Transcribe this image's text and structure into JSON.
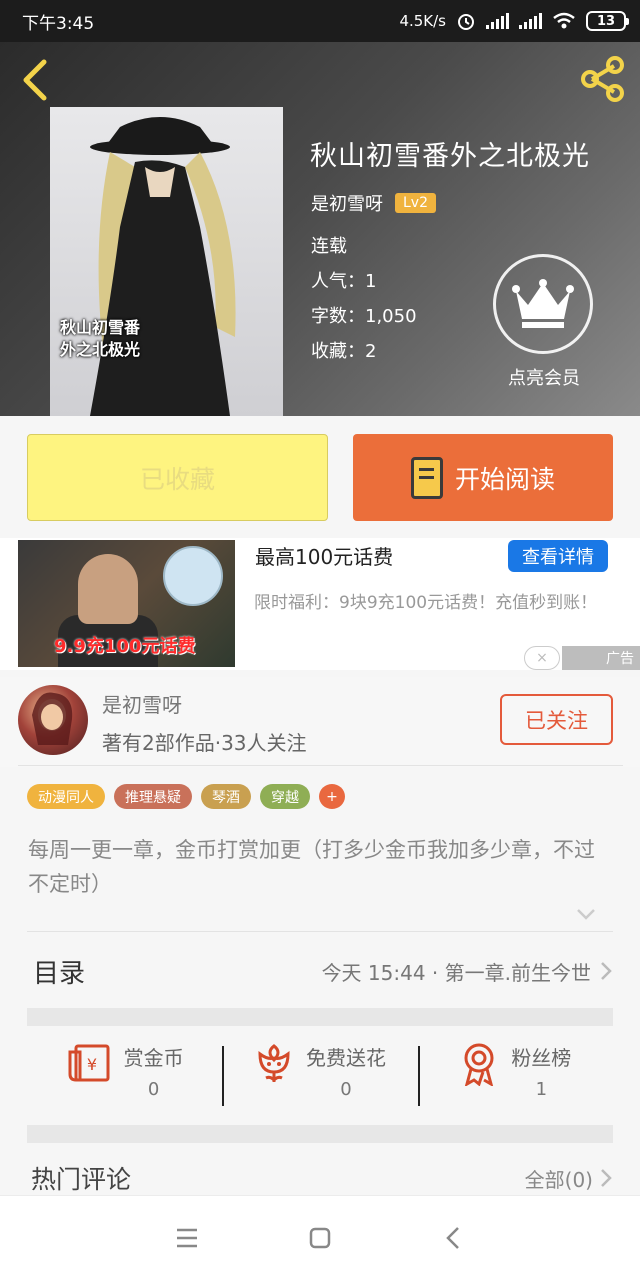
{
  "status_bar": {
    "time": "下午3:45",
    "net_speed": "4.5K/s",
    "battery": "13"
  },
  "book": {
    "title": "秋山初雪番外之北极光",
    "author": "是初雪呀",
    "level": "Lv2",
    "status": "连载",
    "popularity": "人气：1",
    "word_count": "字数：1,050",
    "favorites": "收藏：2",
    "cover_text_line1": "秋山初雪番",
    "cover_text_line2": "外之北极光",
    "vip_label": "点亮会员"
  },
  "actions": {
    "collected_label": "已收藏",
    "read_label": "开始阅读"
  },
  "ad": {
    "title": "最高100元话费",
    "button": "查看详情",
    "description": "限时福利：9块9充100元话费！充值秒到账！",
    "image_text": "9.9充100元话费",
    "tag": "广告",
    "close_symbol": "×"
  },
  "author_card": {
    "name": "是初雪呀",
    "stats": "著有2部作品·33人关注",
    "follow_label": "已关注"
  },
  "tags": [
    {
      "label": "动漫同人",
      "color": "#f0b33e"
    },
    {
      "label": "推理悬疑",
      "color": "#c9715a"
    },
    {
      "label": "琴酒",
      "color": "#c9a050"
    },
    {
      "label": "穿越",
      "color": "#8fae55"
    },
    {
      "label": "+",
      "color": "#e9683f"
    }
  ],
  "description": "每周一更一章，金币打赏加更（打多少金币我加多少章，不过不定时）",
  "toc": {
    "label": "目录",
    "latest": "今天 15:44 · 第一章.前生今世"
  },
  "rewards": [
    {
      "label": "赏金币",
      "count": "0",
      "icon": "red-envelope-icon"
    },
    {
      "label": "免费送花",
      "count": "0",
      "icon": "flower-icon"
    },
    {
      "label": "粉丝榜",
      "count": "1",
      "icon": "medal-icon"
    }
  ],
  "comments": {
    "title": "热门评论",
    "all_label": "全部(0)"
  },
  "colors": {
    "accent_orange": "#eb6e3a",
    "collected_yellow": "#fef480",
    "follow_red": "#e45a3b",
    "ad_blue": "#1a78e6",
    "icon_red": "#d44a2a"
  }
}
